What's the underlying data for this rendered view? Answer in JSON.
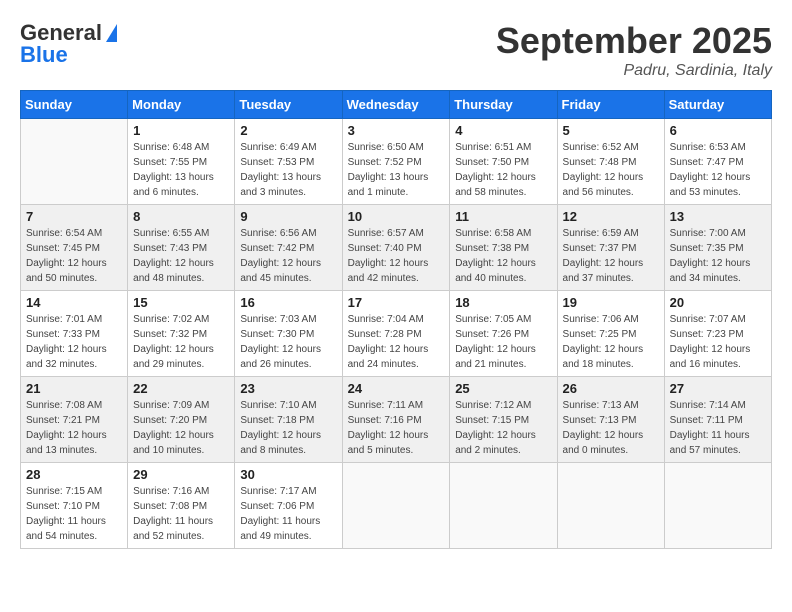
{
  "header": {
    "logo_line1": "General",
    "logo_line2": "Blue",
    "month_title": "September 2025",
    "location": "Padru, Sardinia, Italy"
  },
  "weekdays": [
    "Sunday",
    "Monday",
    "Tuesday",
    "Wednesday",
    "Thursday",
    "Friday",
    "Saturday"
  ],
  "weeks": [
    [
      {
        "day": "",
        "info": ""
      },
      {
        "day": "1",
        "info": "Sunrise: 6:48 AM\nSunset: 7:55 PM\nDaylight: 13 hours\nand 6 minutes."
      },
      {
        "day": "2",
        "info": "Sunrise: 6:49 AM\nSunset: 7:53 PM\nDaylight: 13 hours\nand 3 minutes."
      },
      {
        "day": "3",
        "info": "Sunrise: 6:50 AM\nSunset: 7:52 PM\nDaylight: 13 hours\nand 1 minute."
      },
      {
        "day": "4",
        "info": "Sunrise: 6:51 AM\nSunset: 7:50 PM\nDaylight: 12 hours\nand 58 minutes."
      },
      {
        "day": "5",
        "info": "Sunrise: 6:52 AM\nSunset: 7:48 PM\nDaylight: 12 hours\nand 56 minutes."
      },
      {
        "day": "6",
        "info": "Sunrise: 6:53 AM\nSunset: 7:47 PM\nDaylight: 12 hours\nand 53 minutes."
      }
    ],
    [
      {
        "day": "7",
        "info": "Sunrise: 6:54 AM\nSunset: 7:45 PM\nDaylight: 12 hours\nand 50 minutes."
      },
      {
        "day": "8",
        "info": "Sunrise: 6:55 AM\nSunset: 7:43 PM\nDaylight: 12 hours\nand 48 minutes."
      },
      {
        "day": "9",
        "info": "Sunrise: 6:56 AM\nSunset: 7:42 PM\nDaylight: 12 hours\nand 45 minutes."
      },
      {
        "day": "10",
        "info": "Sunrise: 6:57 AM\nSunset: 7:40 PM\nDaylight: 12 hours\nand 42 minutes."
      },
      {
        "day": "11",
        "info": "Sunrise: 6:58 AM\nSunset: 7:38 PM\nDaylight: 12 hours\nand 40 minutes."
      },
      {
        "day": "12",
        "info": "Sunrise: 6:59 AM\nSunset: 7:37 PM\nDaylight: 12 hours\nand 37 minutes."
      },
      {
        "day": "13",
        "info": "Sunrise: 7:00 AM\nSunset: 7:35 PM\nDaylight: 12 hours\nand 34 minutes."
      }
    ],
    [
      {
        "day": "14",
        "info": "Sunrise: 7:01 AM\nSunset: 7:33 PM\nDaylight: 12 hours\nand 32 minutes."
      },
      {
        "day": "15",
        "info": "Sunrise: 7:02 AM\nSunset: 7:32 PM\nDaylight: 12 hours\nand 29 minutes."
      },
      {
        "day": "16",
        "info": "Sunrise: 7:03 AM\nSunset: 7:30 PM\nDaylight: 12 hours\nand 26 minutes."
      },
      {
        "day": "17",
        "info": "Sunrise: 7:04 AM\nSunset: 7:28 PM\nDaylight: 12 hours\nand 24 minutes."
      },
      {
        "day": "18",
        "info": "Sunrise: 7:05 AM\nSunset: 7:26 PM\nDaylight: 12 hours\nand 21 minutes."
      },
      {
        "day": "19",
        "info": "Sunrise: 7:06 AM\nSunset: 7:25 PM\nDaylight: 12 hours\nand 18 minutes."
      },
      {
        "day": "20",
        "info": "Sunrise: 7:07 AM\nSunset: 7:23 PM\nDaylight: 12 hours\nand 16 minutes."
      }
    ],
    [
      {
        "day": "21",
        "info": "Sunrise: 7:08 AM\nSunset: 7:21 PM\nDaylight: 12 hours\nand 13 minutes."
      },
      {
        "day": "22",
        "info": "Sunrise: 7:09 AM\nSunset: 7:20 PM\nDaylight: 12 hours\nand 10 minutes."
      },
      {
        "day": "23",
        "info": "Sunrise: 7:10 AM\nSunset: 7:18 PM\nDaylight: 12 hours\nand 8 minutes."
      },
      {
        "day": "24",
        "info": "Sunrise: 7:11 AM\nSunset: 7:16 PM\nDaylight: 12 hours\nand 5 minutes."
      },
      {
        "day": "25",
        "info": "Sunrise: 7:12 AM\nSunset: 7:15 PM\nDaylight: 12 hours\nand 2 minutes."
      },
      {
        "day": "26",
        "info": "Sunrise: 7:13 AM\nSunset: 7:13 PM\nDaylight: 12 hours\nand 0 minutes."
      },
      {
        "day": "27",
        "info": "Sunrise: 7:14 AM\nSunset: 7:11 PM\nDaylight: 11 hours\nand 57 minutes."
      }
    ],
    [
      {
        "day": "28",
        "info": "Sunrise: 7:15 AM\nSunset: 7:10 PM\nDaylight: 11 hours\nand 54 minutes."
      },
      {
        "day": "29",
        "info": "Sunrise: 7:16 AM\nSunset: 7:08 PM\nDaylight: 11 hours\nand 52 minutes."
      },
      {
        "day": "30",
        "info": "Sunrise: 7:17 AM\nSunset: 7:06 PM\nDaylight: 11 hours\nand 49 minutes."
      },
      {
        "day": "",
        "info": ""
      },
      {
        "day": "",
        "info": ""
      },
      {
        "day": "",
        "info": ""
      },
      {
        "day": "",
        "info": ""
      }
    ]
  ]
}
